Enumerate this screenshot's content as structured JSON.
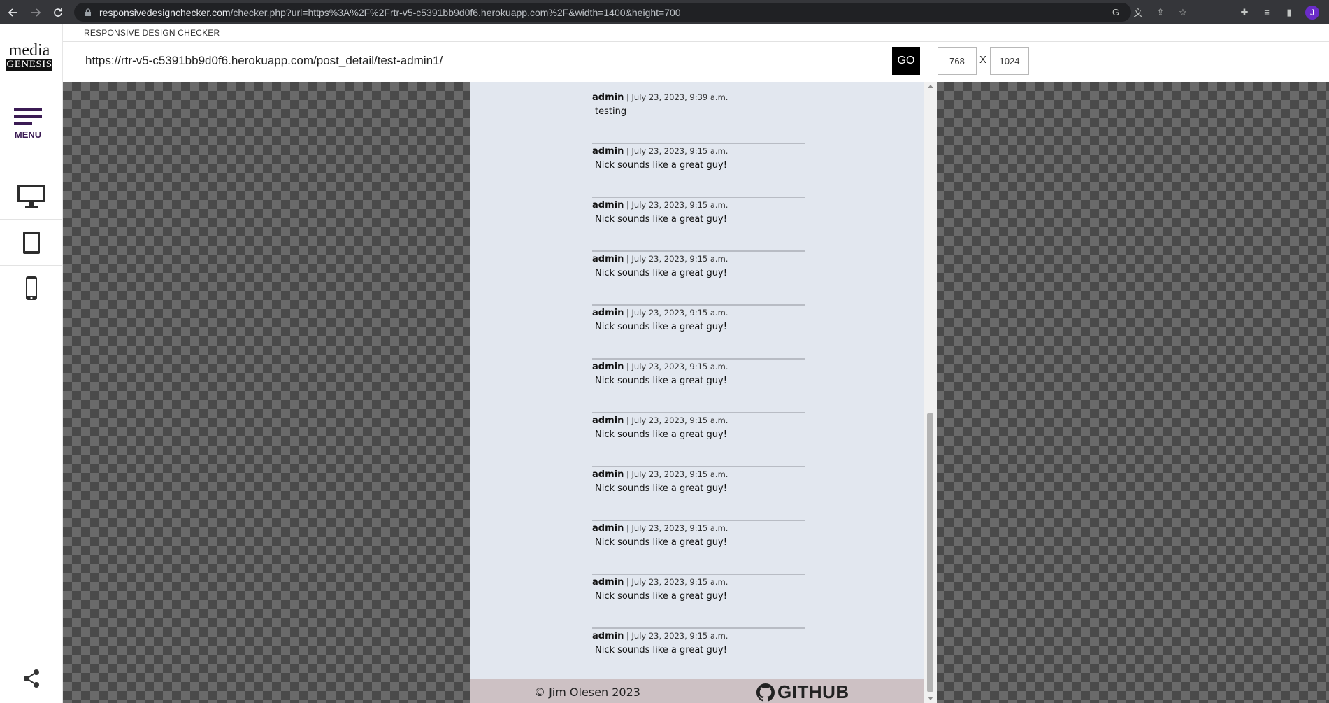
{
  "browser": {
    "url_host": "responsivedesignchecker.com",
    "url_rest": "/checker.php?url=https%3A%2F%2Frtr-v5-c5391bb9d0f6.herokuapp.com%2F&width=1400&height=700",
    "avatar_letter": "J"
  },
  "sidebar": {
    "logo_top": "media",
    "logo_bottom": "GENESIS",
    "menu_label": "MENU",
    "devices": [
      "desktop-icon",
      "tablet-icon",
      "phone-icon"
    ]
  },
  "checker": {
    "title": "RESPONSIVE DESIGN CHECKER",
    "url_value": "https://rtr-v5-c5391bb9d0f6.herokuapp.com/post_detail/test-admin1/",
    "go_label": "GO",
    "width_value": "768",
    "height_value": "1024",
    "x_label": "X"
  },
  "site": {
    "comments": [
      {
        "author": "admin",
        "date": "| July 23, 2023, 9:39 a.m.",
        "body": "testing"
      },
      {
        "author": "admin",
        "date": "| July 23, 2023, 9:15 a.m.",
        "body": "Nick sounds like a great guy!"
      },
      {
        "author": "admin",
        "date": "| July 23, 2023, 9:15 a.m.",
        "body": "Nick sounds like a great guy!"
      },
      {
        "author": "admin",
        "date": "| July 23, 2023, 9:15 a.m.",
        "body": "Nick sounds like a great guy!"
      },
      {
        "author": "admin",
        "date": "| July 23, 2023, 9:15 a.m.",
        "body": "Nick sounds like a great guy!"
      },
      {
        "author": "admin",
        "date": "| July 23, 2023, 9:15 a.m.",
        "body": "Nick sounds like a great guy!"
      },
      {
        "author": "admin",
        "date": "| July 23, 2023, 9:15 a.m.",
        "body": "Nick sounds like a great guy!"
      },
      {
        "author": "admin",
        "date": "| July 23, 2023, 9:15 a.m.",
        "body": "Nick sounds like a great guy!"
      },
      {
        "author": "admin",
        "date": "| July 23, 2023, 9:15 a.m.",
        "body": "Nick sounds like a great guy!"
      },
      {
        "author": "admin",
        "date": "| July 23, 2023, 9:15 a.m.",
        "body": "Nick sounds like a great guy!"
      },
      {
        "author": "admin",
        "date": "| July 23, 2023, 9:15 a.m.",
        "body": "Nick sounds like a great guy!"
      }
    ],
    "footer_copyright": "© Jim Olesen 2023",
    "footer_github": "GITHUB"
  },
  "colors": {
    "accent_purple": "#3b1b54",
    "frame_bg": "#e2e7ef",
    "footer_bg": "#cdc1c4"
  }
}
